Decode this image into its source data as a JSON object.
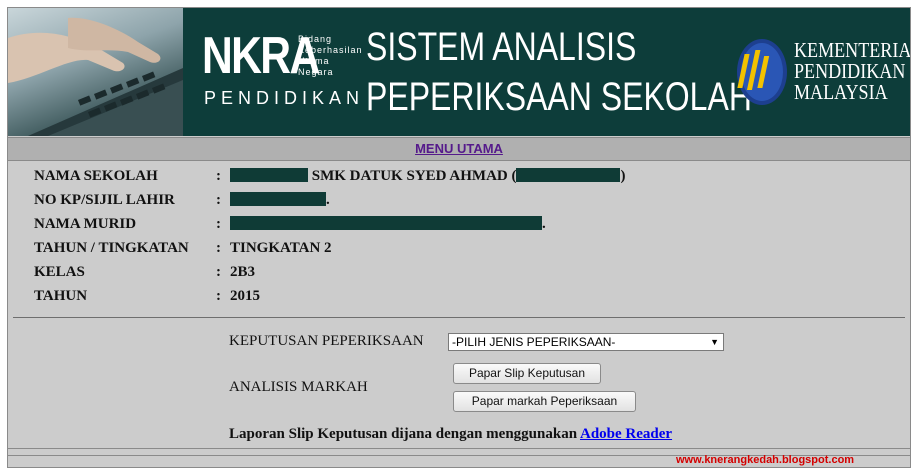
{
  "banner": {
    "nkra": "NKRA",
    "nkra_sub": [
      "Bidang",
      "Keberhasilan",
      "Utama",
      "Negara"
    ],
    "nkra_pendidikan": "PENDIDIKAN",
    "title_line1": "SISTEM ANALISIS",
    "title_line2": "PEPERIKSAAN SEKOLAH",
    "ministry": [
      "KEMENTERIAN",
      "PENDIDIKAN",
      "MALAYSIA"
    ]
  },
  "menu": {
    "label": "MENU UTAMA"
  },
  "student": {
    "school": {
      "label": "NAMA SEKOLAH",
      "value": "SMK DATUK SYED AHMAD (",
      "suffix": ")"
    },
    "ic": {
      "label": "NO KP/SIJIL LAHIR",
      "value": "."
    },
    "name": {
      "label": "NAMA MURID",
      "value": "."
    },
    "form": {
      "label": "TAHUN / TINGKATAN",
      "value": "TINGKATAN 2"
    },
    "class": {
      "label": "KELAS",
      "value": "2B3"
    },
    "year": {
      "label": "TAHUN",
      "value": "2015"
    },
    "colon": ":"
  },
  "form": {
    "exam_label": "KEPUTUSAN PEPERIKSAAN",
    "exam_select_value": "-PILIH JENIS PEPERIKSAAN-",
    "analysis_label": "ANALISIS MARKAH",
    "btn_slip": "Papar Slip Keputusan",
    "btn_marks": "Papar markah Peperiksaan"
  },
  "footer": {
    "note": "Laporan Slip Keputusan dijana dengan menggunakan",
    "link": "Adobe Reader"
  },
  "watermark": "www.knerangkedah.blogspot.com",
  "colors": {
    "banner_bg": "#0d3d3a",
    "panel_bg": "#cccccc",
    "redaction": "#0f3b36",
    "watermark": "#d40000"
  }
}
